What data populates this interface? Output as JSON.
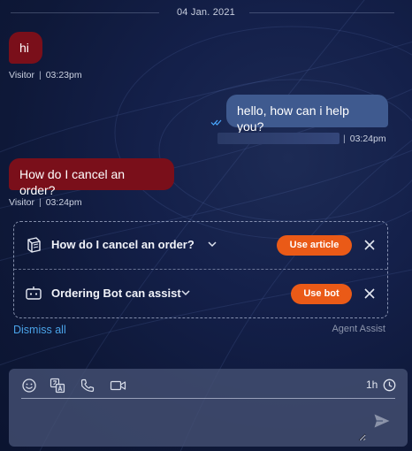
{
  "date_divider": "04 Jan. 2021",
  "messages": [
    {
      "role": "visitor",
      "text": "hi",
      "author": "Visitor",
      "time": "03:23pm"
    },
    {
      "role": "agent",
      "text": "hello, how can i help you?",
      "time": "03:24pm",
      "author_masked": true,
      "read_receipt_icon": "double-check-icon"
    },
    {
      "role": "visitor",
      "text": "How do I cancel an order?",
      "author": "Visitor",
      "time": "03:24pm"
    }
  ],
  "assist": {
    "items": [
      {
        "icon": "book-icon",
        "label": "How do I cancel an order?",
        "action": "Use article"
      },
      {
        "icon": "bot-icon",
        "label": "Ordering Bot can assist",
        "action": "Use bot"
      }
    ],
    "dismiss_label": "Dismiss all",
    "footer_label": "Agent Assist"
  },
  "composer": {
    "tools": [
      "emoji-icon",
      "translate-icon",
      "phone-icon",
      "video-icon"
    ],
    "timer": "1h",
    "timer_icon": "clock-icon",
    "placeholder": "",
    "send_icon": "send-icon"
  },
  "colors": {
    "visitor_bubble": "#7a0f1a",
    "agent_bubble": "#3f5a8f",
    "accent_button": "#ea5a17",
    "link": "#4aa3e8",
    "read_receipt": "#4aa8ff"
  }
}
